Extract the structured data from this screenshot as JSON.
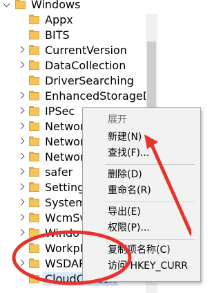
{
  "tree": {
    "root_label": "Windows",
    "items": [
      {
        "label": "Appx",
        "expandable": false
      },
      {
        "label": "BITS",
        "expandable": false
      },
      {
        "label": "CurrentVersion",
        "expandable": true
      },
      {
        "label": "DataCollection",
        "expandable": true
      },
      {
        "label": "DriverSearching",
        "expandable": false
      },
      {
        "label": "EnhancedStorageDe",
        "expandable": true
      },
      {
        "label": "IPSec",
        "expandable": true
      },
      {
        "label": "Networ",
        "expandable": true
      },
      {
        "label": "Networ",
        "expandable": true
      },
      {
        "label": "Networ",
        "expandable": true
      },
      {
        "label": "safer",
        "expandable": true
      },
      {
        "label": "Setting",
        "expandable": true
      },
      {
        "label": "System",
        "expandable": true
      },
      {
        "label": "WcmSv",
        "expandable": true
      },
      {
        "label": "Windo",
        "expandable": true
      },
      {
        "label": "Workpl",
        "expandable": false
      },
      {
        "label": "WSDAP",
        "expandable": true
      },
      {
        "label": "CloudConten",
        "expandable": false,
        "selected": true
      }
    ]
  },
  "context_menu": {
    "expand": "展开",
    "new": "新建(N)",
    "find": "查找(F)...",
    "delete": "删除(D)",
    "rename": "重命名(R)",
    "export": "导出(E)",
    "permissions": "权限(P)...",
    "copy_key_name": "复制项名称(C)",
    "visit": "访问 HKEY_CURR"
  },
  "colors": {
    "annotation": "#e8322c",
    "folder": "#f2c45a",
    "selection": "#d9e9fb",
    "menu_bg": "#f2f2f2"
  }
}
